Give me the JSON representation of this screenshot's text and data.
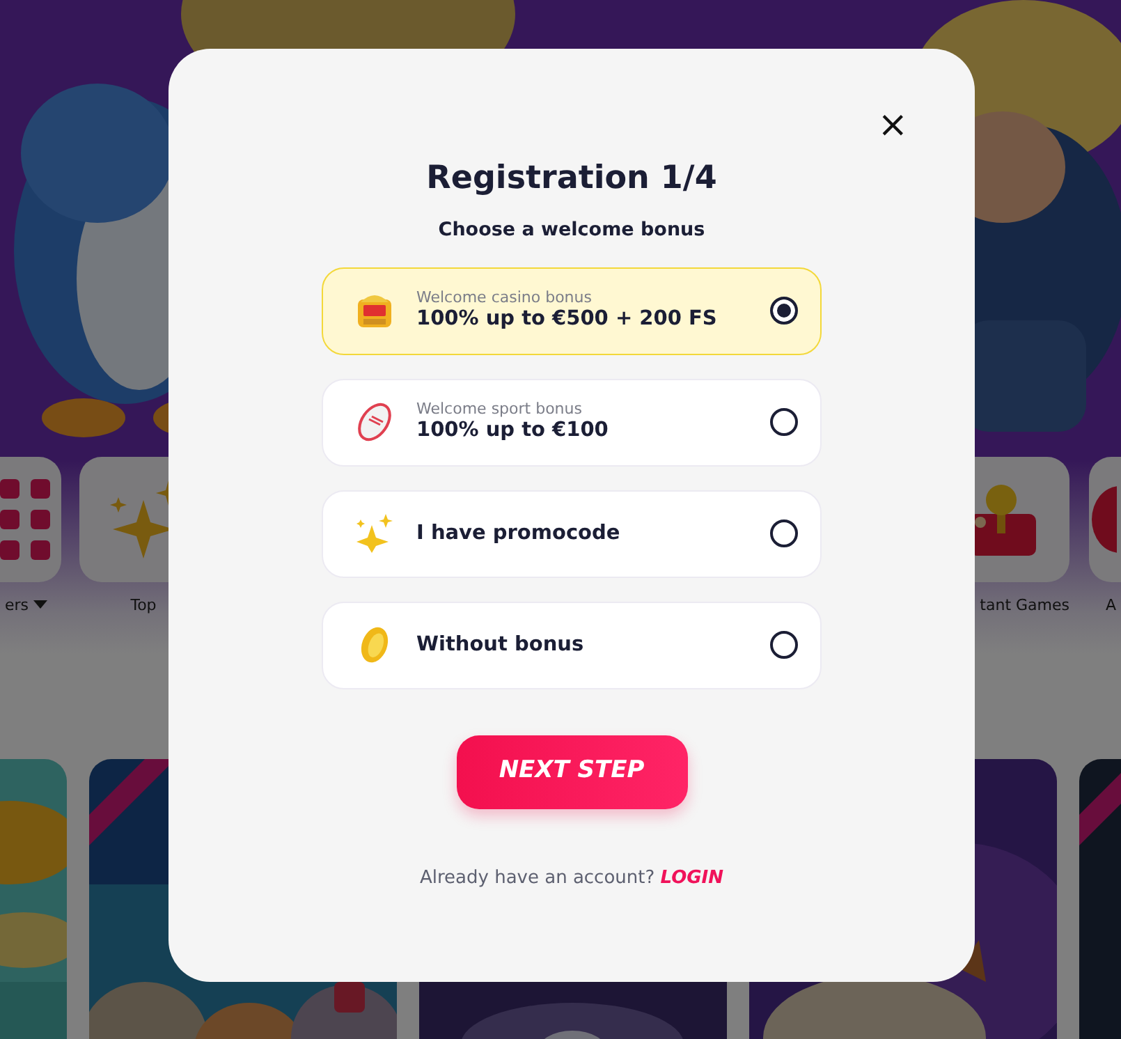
{
  "categories": [
    {
      "label": "ers",
      "dropdown": true
    },
    {
      "label": "Top",
      "dropdown": false
    },
    {
      "label": "tant Games",
      "dropdown": false
    },
    {
      "label": "A",
      "dropdown": false
    }
  ],
  "modal": {
    "close": "×",
    "title": "Registration 1/4",
    "subtitle": "Choose a welcome bonus",
    "options": [
      {
        "label": "Welcome casino bonus",
        "title": "100% up to €500 + 200 FS",
        "selected": true
      },
      {
        "label": "Welcome sport bonus",
        "title": "100% up to €100",
        "selected": false
      },
      {
        "title": "I have promocode",
        "selected": false
      },
      {
        "title": "Without bonus",
        "selected": false
      }
    ],
    "button": "NEXT STEP",
    "login_prompt": {
      "text": "Already have an account?",
      "link": "LOGIN"
    }
  }
}
